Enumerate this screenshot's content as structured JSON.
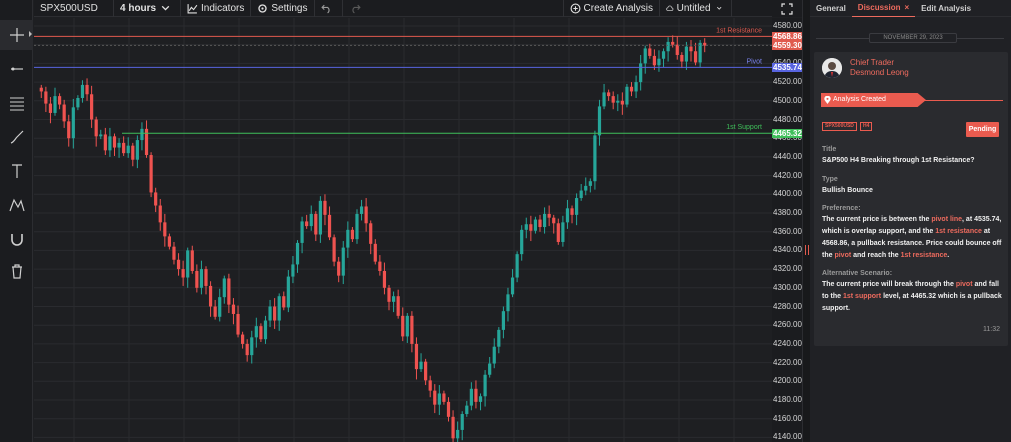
{
  "toolbar": {
    "symbol": "SPX500USD",
    "timeframe": "4 hours",
    "indicators_label": "Indicators",
    "settings_label": "Settings",
    "create_analysis_label": "Create Analysis",
    "layout_name": "Untitled"
  },
  "levels": {
    "resistance_label": "1st Resistance",
    "resistance_value": "4568.86",
    "current_value": "4559.30",
    "pivot_label": "Pivot",
    "pivot_value": "4535.74",
    "support_label": "1st Support",
    "support_value": "4465.32"
  },
  "colors": {
    "up": "#26a69a",
    "down": "#ef5350",
    "resistance": "#e05a4e",
    "pivot": "#5864e0",
    "support": "#3fbf5a",
    "accent": "#ea5b4f"
  },
  "axis": {
    "ticks": [
      "4580.00",
      "4560.00",
      "4540.00",
      "4520.00",
      "4500.00",
      "4480.00",
      "4460.00",
      "4440.00",
      "4420.00",
      "4400.00",
      "4380.00",
      "4360.00",
      "4340.00",
      "4320.00",
      "4300.00",
      "4280.00",
      "4260.00",
      "4240.00",
      "4220.00",
      "4200.00",
      "4180.00",
      "4160.00",
      "4140.00"
    ]
  },
  "panel": {
    "tabs": [
      "General",
      "Discussion",
      "Edit Analysis"
    ],
    "date": "NOVEMBER 29, 2023",
    "author_role": "Chief Trader",
    "author_name": "Desmond Leong",
    "analysis_created": "Analysis Created",
    "symbol_badge": "SPX500USD",
    "timeframe_badge": "H4",
    "status": "Pending",
    "title_label": "Title",
    "title_value": "S&P500 H4 Breaking through 1st Resistance?",
    "type_label": "Type",
    "type_value": "Bullish Bounce",
    "preference_label": "Preference:",
    "preference_parts": [
      "The current price is between the ",
      "pivot line",
      ", at 4535.74, which is overlap support, and the ",
      "1st resistance",
      " at 4568.86, a pullback resistance. Price could bounce off the ",
      "pivot",
      " and reach the ",
      "1st resistance",
      "."
    ],
    "alt_label": "Alternative Scenario:",
    "alt_parts": [
      "The current price will break through the ",
      "pivot",
      " and fall to the ",
      "1st support",
      " level, at 4465.32 which is a pullback support."
    ],
    "time": "11:32"
  },
  "candle_closes": [
    4510,
    4497,
    4487,
    4505,
    4496,
    4478,
    4460,
    4493,
    4503,
    4517,
    4507,
    4480,
    4462,
    4464,
    4447,
    4462,
    4450,
    4455,
    4444,
    4452,
    4437,
    4458,
    4470,
    4442,
    4402,
    4388,
    4370,
    4355,
    4344,
    4330,
    4320,
    4311,
    4340,
    4318,
    4300,
    4320,
    4302,
    4280,
    4269,
    4290,
    4310,
    4282,
    4272,
    4250,
    4240,
    4228,
    4247,
    4259,
    4245,
    4265,
    4280,
    4265,
    4291,
    4279,
    4312,
    4325,
    4348,
    4371,
    4366,
    4379,
    4357,
    4393,
    4378,
    4354,
    4328,
    4313,
    4343,
    4362,
    4352,
    4379,
    4387,
    4369,
    4347,
    4328,
    4318,
    4300,
    4285,
    4291,
    4270,
    4248,
    4270,
    4240,
    4213,
    4221,
    4201,
    4190,
    4175,
    4187,
    4178,
    4162,
    4139,
    4148,
    4165,
    4174,
    4192,
    4178,
    4184,
    4207,
    4219,
    4237,
    4255,
    4275,
    4293,
    4311,
    4336,
    4362,
    4368,
    4361,
    4373,
    4365,
    4379,
    4375,
    4369,
    4349,
    4370,
    4385,
    4378,
    4396,
    4404,
    4409,
    4414,
    4463,
    4494,
    4509,
    4505,
    4498,
    4500,
    4496,
    4515,
    4510,
    4520,
    4540,
    4556,
    4548,
    4538,
    4545,
    4553,
    4563,
    4560,
    4549,
    4542,
    4558,
    4553,
    4541,
    4562,
    4559
  ]
}
